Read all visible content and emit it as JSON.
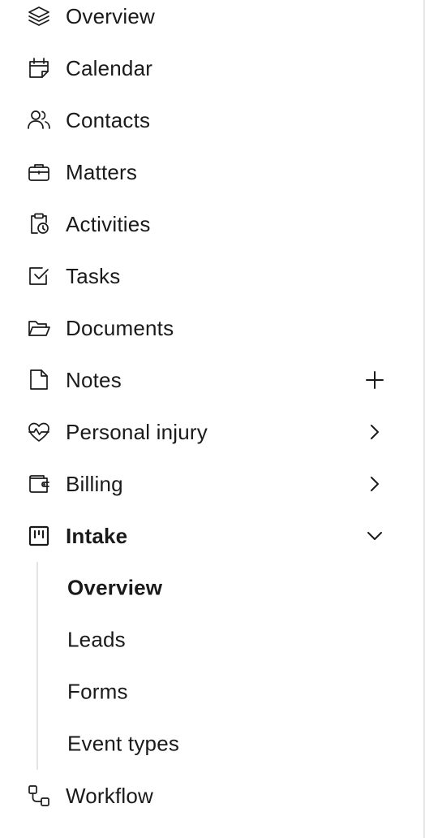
{
  "nav": {
    "overview": {
      "label": "Overview",
      "icon": "layers-icon"
    },
    "calendar": {
      "label": "Calendar",
      "icon": "calendar-icon"
    },
    "contacts": {
      "label": "Contacts",
      "icon": "users-icon"
    },
    "matters": {
      "label": "Matters",
      "icon": "briefcase-icon"
    },
    "activities": {
      "label": "Activities",
      "icon": "clipboard-clock-icon"
    },
    "tasks": {
      "label": "Tasks",
      "icon": "checkbox-icon"
    },
    "documents": {
      "label": "Documents",
      "icon": "folder-open-icon"
    },
    "notes": {
      "label": "Notes",
      "icon": "note-icon",
      "trailing": "plus-icon"
    },
    "personal_injury": {
      "label": "Personal injury",
      "icon": "heart-pulse-icon",
      "trailing": "chevron-right-icon"
    },
    "billing": {
      "label": "Billing",
      "icon": "wallet-icon",
      "trailing": "chevron-right-icon"
    },
    "intake": {
      "label": "Intake",
      "icon": "kanban-icon",
      "trailing": "chevron-down-icon",
      "expanded": true,
      "active": true,
      "children": [
        {
          "label": "Overview",
          "active": true
        },
        {
          "label": "Leads"
        },
        {
          "label": "Forms"
        },
        {
          "label": "Event types"
        }
      ]
    },
    "workflow": {
      "label": "Workflow",
      "icon": "workflow-icon"
    }
  },
  "colors": {
    "text": "#1a1a1a",
    "rail": "#e3e3e3",
    "border": "#e6e6e6",
    "background": "#ffffff"
  }
}
